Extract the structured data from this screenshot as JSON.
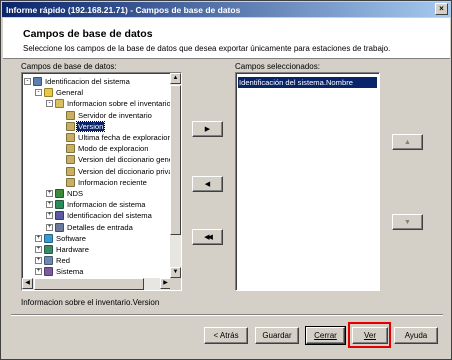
{
  "window": {
    "title": "Informe rápido (192.168.21.71) - Campos de base de datos",
    "close_glyph": "×"
  },
  "header": {
    "title": "Campos de base de datos",
    "description": "Seleccione los campos de la base de datos que desea exportar únicamente para estaciones de trabajo."
  },
  "left_panel": {
    "label": "Campos de base de datos:"
  },
  "right_panel": {
    "label": "Campos seleccionados:"
  },
  "tree": [
    {
      "label": "Identificacion del sistema",
      "level": 0,
      "expander": "-",
      "icon": "database-icon",
      "color": "#5a7fb0"
    },
    {
      "label": "General",
      "level": 1,
      "expander": "-",
      "icon": "folder-open-icon",
      "color": "#e8c840"
    },
    {
      "label": "Informacion sobre el inventario",
      "level": 2,
      "expander": "-",
      "icon": "table-icon",
      "color": "#d8c060"
    },
    {
      "label": "Servidor de inventario",
      "level": 3,
      "expander": "",
      "icon": "field-icon",
      "color": "#c8b060"
    },
    {
      "label": "Version",
      "level": 3,
      "expander": "",
      "icon": "field-icon",
      "color": "#c8b060",
      "selected": true
    },
    {
      "label": "Ultima fecha de exploracion",
      "level": 3,
      "expander": "",
      "icon": "field-icon",
      "color": "#c8b060"
    },
    {
      "label": "Modo de exploracion",
      "level": 3,
      "expander": "",
      "icon": "field-icon",
      "color": "#c8b060"
    },
    {
      "label": "Version del diccionario gener",
      "level": 3,
      "expander": "",
      "icon": "field-icon",
      "color": "#c8b060"
    },
    {
      "label": "Version del diccionario privac",
      "level": 3,
      "expander": "",
      "icon": "field-icon",
      "color": "#c8b060"
    },
    {
      "label": "Informacion reciente",
      "level": 3,
      "expander": "",
      "icon": "field-icon",
      "color": "#c8b060"
    },
    {
      "label": "NDS",
      "level": 2,
      "expander": "+",
      "icon": "nds-icon",
      "color": "#3a8a3a"
    },
    {
      "label": "Informacion de sistema",
      "level": 2,
      "expander": "+",
      "icon": "system-info-icon",
      "color": "#2a8a5a"
    },
    {
      "label": "Identificacion del sistema",
      "level": 2,
      "expander": "+",
      "icon": "system-id-icon",
      "color": "#5a5aa0"
    },
    {
      "label": "Detalles de entrada",
      "level": 2,
      "expander": "+",
      "icon": "login-details-icon",
      "color": "#6a7a9a"
    },
    {
      "label": "Software",
      "level": 1,
      "expander": "+",
      "icon": "software-icon",
      "color": "#3a9ad0"
    },
    {
      "label": "Hardware",
      "level": 1,
      "expander": "+",
      "icon": "hardware-icon",
      "color": "#3a8a6a"
    },
    {
      "label": "Red",
      "level": 1,
      "expander": "+",
      "icon": "network-icon",
      "color": "#6a8ab0"
    },
    {
      "label": "Sistema",
      "level": 1,
      "expander": "+",
      "icon": "system-icon",
      "color": "#7a5aa0"
    }
  ],
  "selected_fields": [
    "Identificación del sistema.Nombre"
  ],
  "status_text": "Informacion sobre el inventario.Version",
  "buttons": {
    "back": "< Atrás",
    "save": "Guardar",
    "close": "Cerrar",
    "view": "Ver",
    "help": "Ayuda"
  },
  "transfer_buttons": {
    "add": "▶",
    "remove": "◀",
    "remove_all": "◀◀"
  },
  "order_buttons": {
    "up": "▲",
    "down": "▼"
  },
  "colors": {
    "title_bar": "#0a246a",
    "selection": "#0a246a",
    "highlight": "#e00000"
  }
}
